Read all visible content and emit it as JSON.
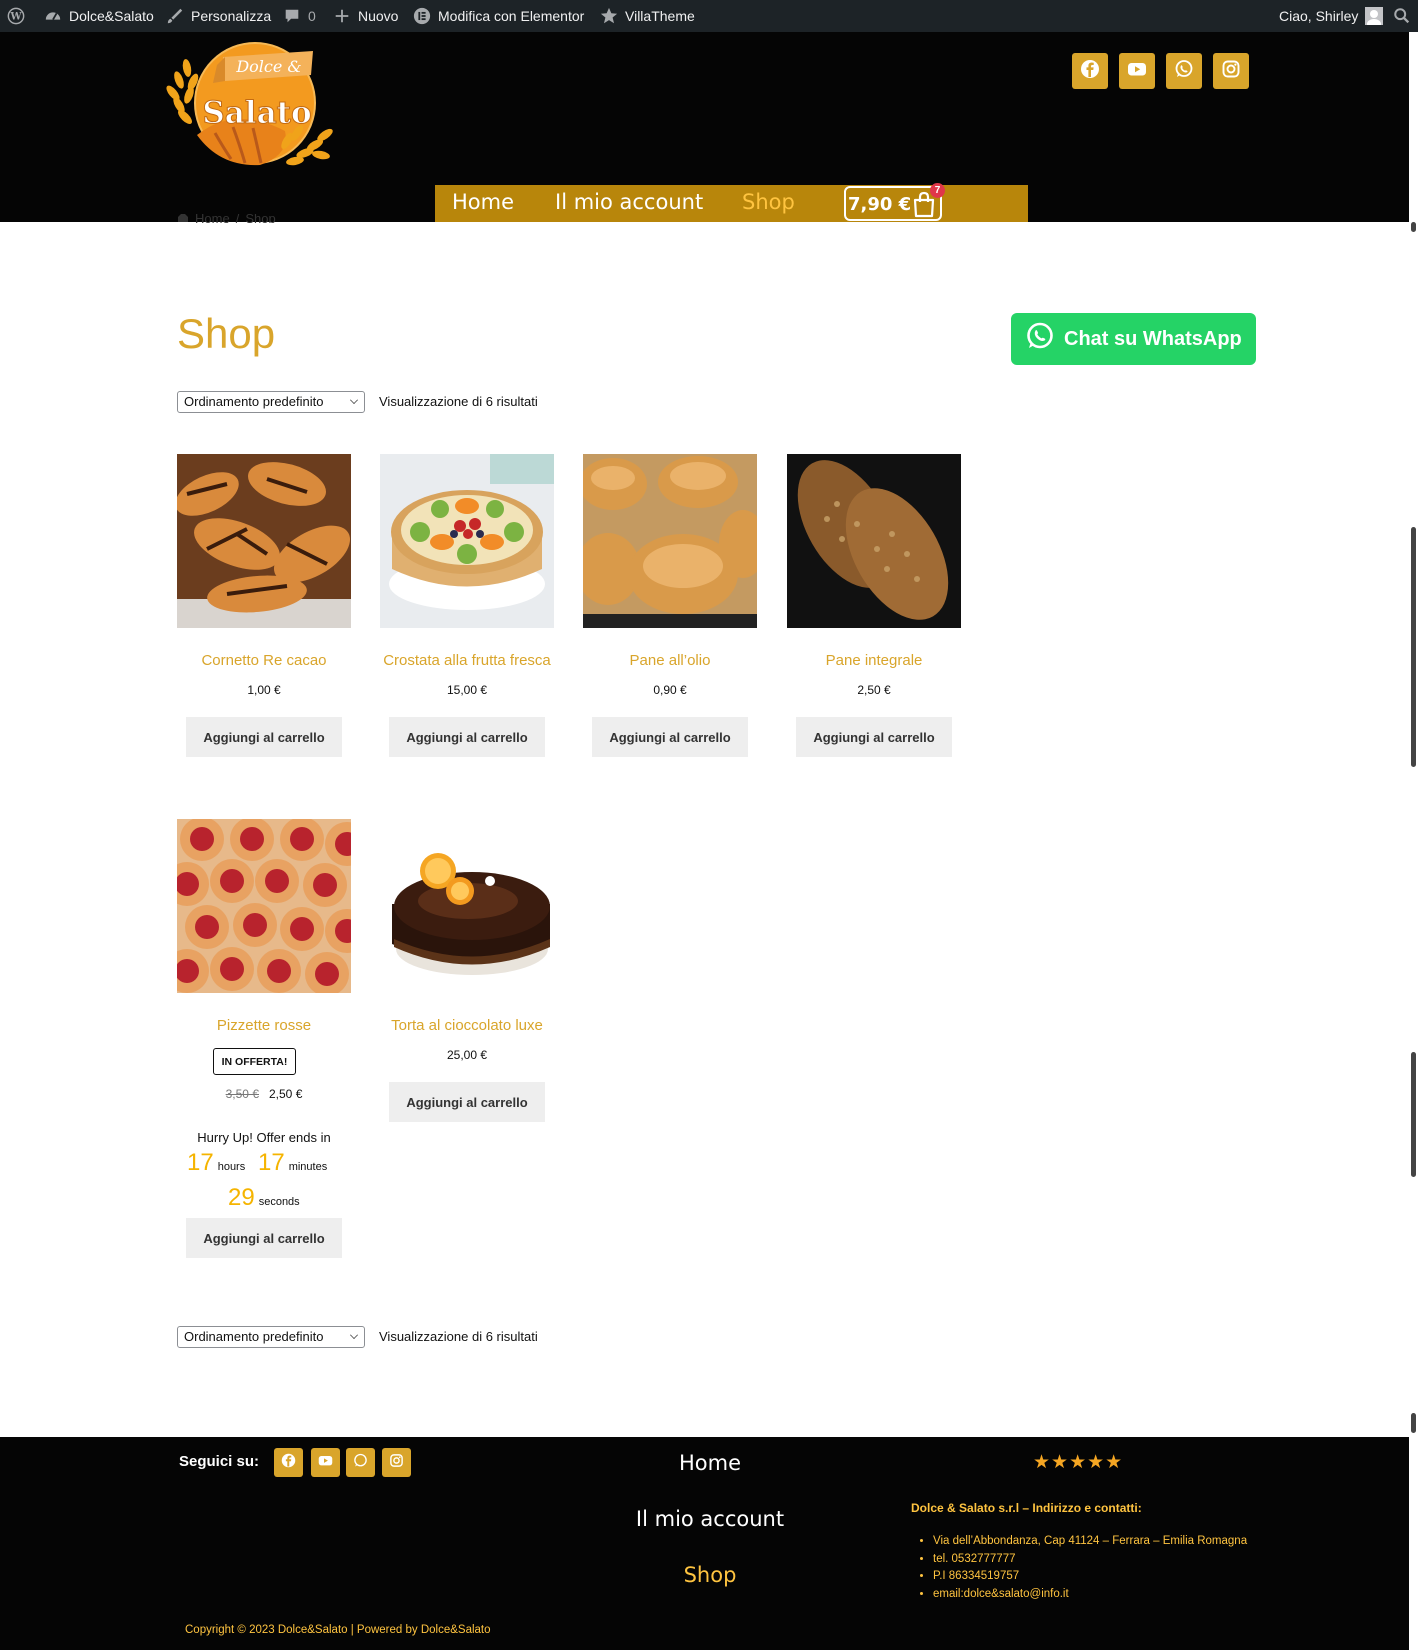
{
  "adminbar": {
    "site_name": "Dolce&Salato",
    "customize": "Personalizza",
    "comments_count": "0",
    "new": "Nuovo",
    "elementor": "Modifica con Elementor",
    "villatheme": "VillaTheme",
    "greeting": "Ciao, Shirley"
  },
  "header": {
    "logo_text_top": "Dolce &",
    "logo_text_bottom": "Salato",
    "social": [
      "facebook-icon",
      "youtube-icon",
      "whatsapp-icon",
      "instagram-icon"
    ],
    "nav": [
      {
        "label": "Home",
        "active": false
      },
      {
        "label": "Il mio account",
        "active": false
      },
      {
        "label": "Shop",
        "active": true
      }
    ],
    "cart_total": "7,90 €",
    "cart_count": "7"
  },
  "breadcrumb": {
    "home": "Home",
    "separator": "/",
    "current": "Shop"
  },
  "page": {
    "title": "Shop",
    "whatsapp_button": "Chat su WhatsApp",
    "sorting_selected": "Ordinamento predefinito",
    "result_count": "Visualizzazione di 6 risultati"
  },
  "products": [
    {
      "title": "Cornetto Re cacao",
      "price": "1,00 €",
      "button": "Aggiungi al carrello"
    },
    {
      "title": "Crostata alla frutta fresca",
      "price": "15,00 €",
      "button": "Aggiungi al carrello"
    },
    {
      "title": "Pane all’olio",
      "price": "0,90 €",
      "button": "Aggiungi al carrello"
    },
    {
      "title": "Pane integrale",
      "price": "2,50 €",
      "button": "Aggiungi al carrello"
    },
    {
      "title": "Pizzette rosse",
      "badge": "IN OFFERTA!",
      "old_price": "3,50 €",
      "price": "2,50 €",
      "hurry": "Hurry Up! Offer ends in",
      "countdown": {
        "hours": "17",
        "hours_label": "hours",
        "minutes": "17",
        "minutes_label": "minutes",
        "seconds": "29",
        "seconds_label": "seconds"
      },
      "button": "Aggiungi al carrello"
    },
    {
      "title": "Torta al cioccolato luxe",
      "price": "25,00 €",
      "button": "Aggiungi al carrello"
    }
  ],
  "footer": {
    "follow_label": "Seguici su:",
    "social": [
      "facebook-icon",
      "youtube-icon",
      "whatsapp-icon",
      "instagram-icon"
    ],
    "nav": [
      {
        "label": "Home",
        "active": false
      },
      {
        "label": "Il mio account",
        "active": false
      },
      {
        "label": "Shop",
        "active": true
      }
    ],
    "rating_stars": "★★★★★",
    "contact_title": "Dolce & Salato s.r.l – Indirizzo e contatti:",
    "contacts": [
      "Via dell’Abbondanza, Cap 41124 – Ferrara – Emilia Romagna",
      "tel. 0532777777",
      "P.I 86334519757",
      "email:dolce&salato@info.it"
    ],
    "copyright": "Copyright © 2023 Dolce&Salato | Powered by Dolce&Salato"
  },
  "colors": {
    "brand_gold": "#d9a52b",
    "nav_bar": "#b8860b",
    "active_link": "#ffc440",
    "whatsapp_green": "#25d366",
    "header_bg": "#050505",
    "adminbar_bg": "#1d2327"
  }
}
